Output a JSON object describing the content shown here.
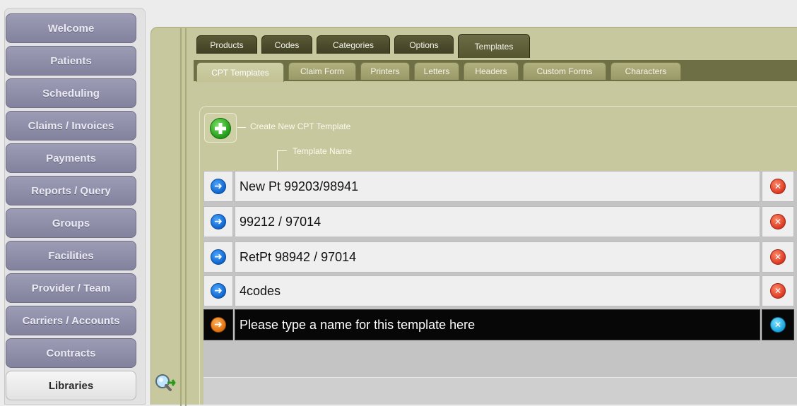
{
  "sidebar": {
    "items": [
      {
        "label": "Welcome"
      },
      {
        "label": "Patients"
      },
      {
        "label": "Scheduling"
      },
      {
        "label": "Claims / Invoices"
      },
      {
        "label": "Payments"
      },
      {
        "label": "Reports / Query"
      },
      {
        "label": "Groups"
      },
      {
        "label": "Facilities"
      },
      {
        "label": "Provider / Team"
      },
      {
        "label": "Carriers / Accounts"
      },
      {
        "label": "Contracts"
      },
      {
        "label": "Libraries",
        "active": true
      }
    ]
  },
  "tabs": {
    "top": [
      "Products",
      "Codes",
      "Categories",
      "Options",
      "Templates"
    ],
    "active_top": "Templates",
    "sub": [
      "CPT Templates",
      "Claim Form",
      "Printers",
      "Letters",
      "Headers",
      "Custom Forms",
      "Characters"
    ],
    "active_sub": "CPT Templates"
  },
  "toolbar": {
    "create_label": "Create New CPT Template",
    "column_label": "Template Name"
  },
  "templates": [
    {
      "name": "New Pt 99203/98941"
    },
    {
      "name": "99212 / 97014"
    },
    {
      "name": "RetPt 98942 / 97014"
    },
    {
      "name": "4codes"
    }
  ],
  "new_template": {
    "placeholder": "Please type a name for this template here"
  },
  "colors": {
    "nav": "#8f8eaa",
    "panel": "#c8c89e",
    "tab_dark": "#4a4a2c",
    "editing_row": "#070707"
  }
}
